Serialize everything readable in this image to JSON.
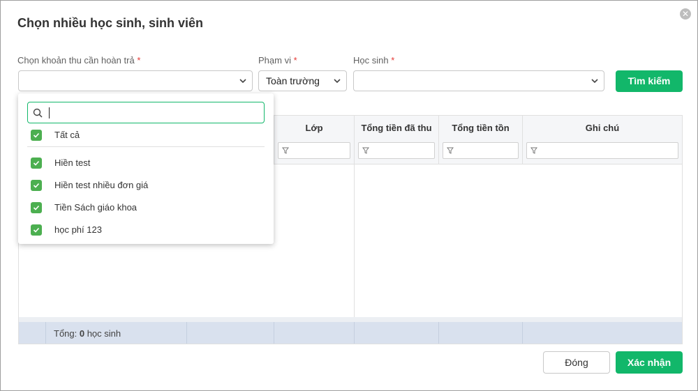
{
  "dialog": {
    "title": "Chọn nhiều học sinh, sinh viên",
    "close_icon": "close-icon"
  },
  "filters": {
    "fee_label": "Chọn khoản thu cần hoàn trả",
    "fee_value": "",
    "scope_label": "Phạm vi",
    "scope_value": "Toàn trường",
    "student_label": "Học sinh",
    "student_value": "",
    "required_mark": "*",
    "search_button": "Tìm kiếm"
  },
  "dropdown": {
    "search_value": "",
    "select_all": "Tất cả",
    "options": [
      {
        "label": "Hiền test",
        "checked": true
      },
      {
        "label": "Hiền test nhiều đơn giá",
        "checked": true
      },
      {
        "label": "Tiền Sách giáo khoa",
        "checked": true
      },
      {
        "label": "học phí 123",
        "checked": true
      }
    ]
  },
  "grid": {
    "columns": [
      "Lớp",
      "Tổng tiền đã thu",
      "Tổng tiền tồn",
      "Ghi chú"
    ],
    "footer_prefix": "Tổng: ",
    "footer_count": "0",
    "footer_suffix": " học sinh"
  },
  "actions": {
    "close_label": "Đóng",
    "confirm_label": "Xác nhận"
  },
  "colors": {
    "accent": "#12b76a",
    "checkbox": "#4caf50",
    "required": "#e53935"
  }
}
